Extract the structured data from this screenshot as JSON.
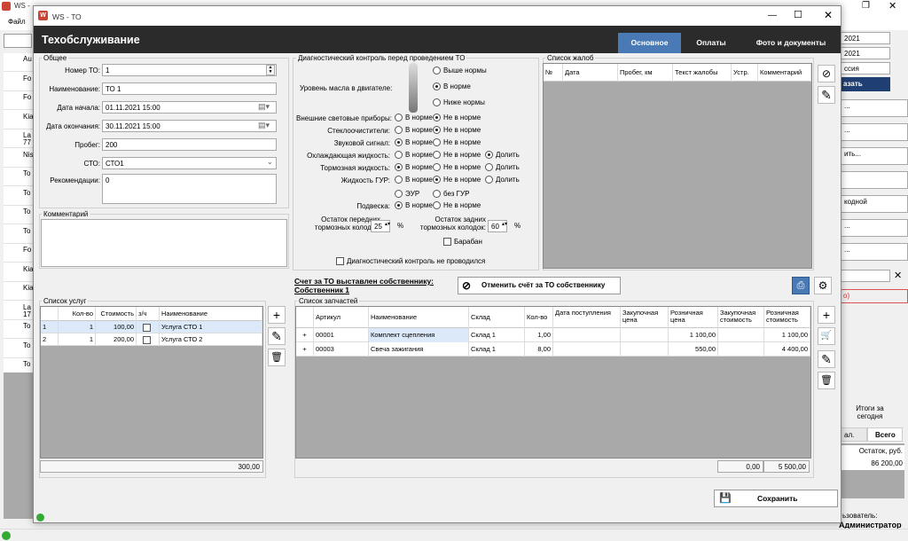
{
  "bg": {
    "title": "WS -",
    "menu_file": "Файл",
    "list": [
      "Au",
      "Fo",
      "Fo",
      "Kia",
      "La 77",
      "Nis",
      "To",
      "To",
      "To",
      "To",
      "Fo",
      "Kia",
      "Kia",
      "La 17",
      "To",
      "To",
      "To"
    ],
    "right_dates": [
      "2021",
      "2021"
    ],
    "right_combo": "ссия",
    "right_btn": "азать",
    "right_items": [
      "...",
      "...",
      "ить...",
      "",
      "кодной",
      "...",
      "...",
      ""
    ],
    "right_red": "о)",
    "totals_label": "Итоги за сегодня",
    "tab1": "ал.",
    "tab2": "Всего",
    "rest_label": "Остаток, руб.",
    "rest_value": "86 200,00",
    "user_label": "ьзователь:",
    "user_value": "Администратор"
  },
  "window": {
    "title": "WS - ТО",
    "header": "Техобслуживание",
    "tabs": [
      "Основное",
      "Оплаты",
      "Фото и документы"
    ]
  },
  "general": {
    "group": "Общее",
    "num_label": "Номер ТО:",
    "num": "1",
    "name_label": "Наименование:",
    "name": "ТО 1",
    "start_label": "Дата начала:",
    "start": "01.11.2021 15:00",
    "end_label": "Дата окончания:",
    "end": "30.11.2021 15:00",
    "mileage_label": "Пробег:",
    "mileage": "200",
    "sto_label": "СТО:",
    "sto": "СТО1",
    "rec_label": "Рекомендации:",
    "rec": "0"
  },
  "comment": {
    "group": "Комментарий"
  },
  "diag": {
    "group": "Диагностический контроль перед проведением ТО",
    "oil_label": "Уровень масла в двигателе:",
    "oil_opts": [
      "Выше нормы",
      "В норме",
      "Ниже нормы"
    ],
    "lights": "Внешние световые приборы:",
    "wipers": "Стеклоочистители:",
    "horn": "Звуковой сигнал:",
    "coolant": "Охлаждающая жидкость:",
    "brake": "Тормозная жидкость:",
    "gur": "Жидкость ГУР:",
    "susp": "Подвеска:",
    "norm": "В норме",
    "not_norm": "Не в норме",
    "top": "Долить",
    "eur": "ЭУР",
    "no_gur": "без ГУР",
    "front_label": "Остаток передних тормозных колодок:",
    "front": "25",
    "rear_label": "Остаток задних тормозных колодок:",
    "rear": "60",
    "pct": "%",
    "drum": "Барабан",
    "not_done": "Диагностический контроль не проводился"
  },
  "complaints": {
    "group": "Список жалоб",
    "headers": [
      "№",
      "Дата",
      "Пробег, км",
      "Текст жалобы",
      "Устр.",
      "Комментарий"
    ]
  },
  "invoice": {
    "title": "Счет за ТО выставлен собственнику: Собственник 1",
    "cancel": "Отменить счёт за ТО собственнику"
  },
  "services": {
    "group": "Список услуг",
    "headers": [
      "Кол-во",
      "Стоимость",
      "з/ч",
      "Наименование"
    ],
    "rows": [
      {
        "n": "1",
        "qty": "1",
        "cost": "100,00",
        "name": "Услуга СТО 1"
      },
      {
        "n": "2",
        "qty": "1",
        "cost": "200,00",
        "name": "Услуга СТО 2"
      }
    ],
    "total": "300,00"
  },
  "parts": {
    "group": "Список запчастей",
    "headers": [
      "Артикул",
      "Наименование",
      "Склад",
      "Кол-во",
      "Дата поступления",
      "Закупочная цена",
      "Розничная цена",
      "Закупочная стоимость",
      "Розничная стоимость"
    ],
    "rows": [
      {
        "art": "00001",
        "name": "Комплект сцепления",
        "wh": "Склад 1",
        "qty": "1,00",
        "date": "",
        "buy": "",
        "retail": "1 100,00",
        "buysum": "",
        "retailsum": "1 100,00"
      },
      {
        "art": "00003",
        "name": "Свеча зажигания",
        "wh": "Склад 1",
        "qty": "8,00",
        "date": "",
        "buy": "",
        "retail": "550,00",
        "buysum": "",
        "retailsum": "4 400,00"
      }
    ],
    "total_buy": "0,00",
    "total_retail": "5 500,00"
  },
  "save": "Сохранить",
  "colors": {
    "dark": "#2b2b2b",
    "tab_active": "#4a7ab5",
    "grid_empty": "#a9a9a9",
    "sel_row": "#dbe9f9"
  }
}
